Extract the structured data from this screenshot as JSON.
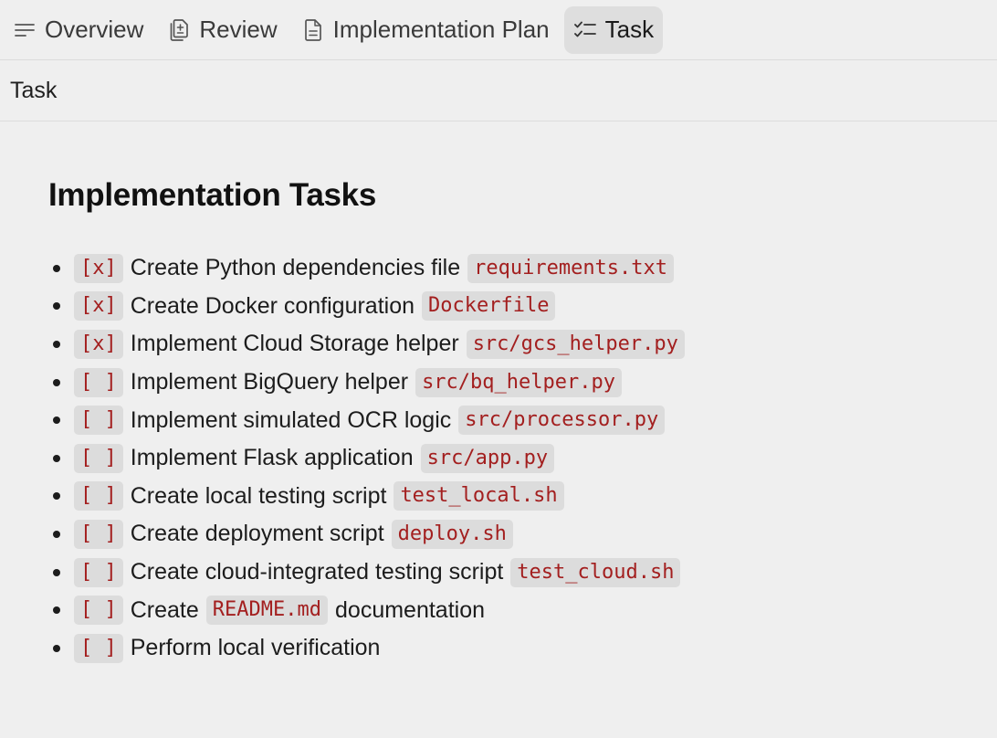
{
  "tabs": [
    {
      "label": "Overview",
      "icon": "list-lines-icon",
      "active": false
    },
    {
      "label": "Review",
      "icon": "copy-document-icon",
      "active": false
    },
    {
      "label": "Implementation Plan",
      "icon": "document-icon",
      "active": false
    },
    {
      "label": "Task",
      "icon": "checklist-icon",
      "active": true
    }
  ],
  "subheader": {
    "title": "Task"
  },
  "main": {
    "heading": "Implementation Tasks",
    "tasks": [
      {
        "check": "[x]",
        "text": "Create Python dependencies file",
        "code": "requirements.txt"
      },
      {
        "check": "[x]",
        "text": "Create Docker configuration",
        "code": "Dockerfile"
      },
      {
        "check": "[x]",
        "text": "Implement Cloud Storage helper",
        "code": "src/gcs_helper.py"
      },
      {
        "check": "[ ]",
        "text": "Implement BigQuery helper",
        "code": "src/bq_helper.py"
      },
      {
        "check": "[ ]",
        "text": "Implement simulated OCR logic",
        "code": "src/processor.py"
      },
      {
        "check": "[ ]",
        "text": "Implement Flask application",
        "code": "src/app.py"
      },
      {
        "check": "[ ]",
        "text": "Create local testing script",
        "code": "test_local.sh"
      },
      {
        "check": "[ ]",
        "text": "Create deployment script",
        "code": "deploy.sh"
      },
      {
        "check": "[ ]",
        "text": "Create cloud-integrated testing script",
        "code": "test_cloud.sh"
      },
      {
        "check": "[ ]",
        "text_before": "Create",
        "code": "README.md",
        "text_after": "documentation"
      },
      {
        "check": "[ ]",
        "text": "Perform local verification"
      }
    ]
  },
  "colors": {
    "background": "#efefef",
    "active_tab": "#dedede",
    "code_background": "#dcdcdc",
    "code_text": "#a31f1f"
  }
}
